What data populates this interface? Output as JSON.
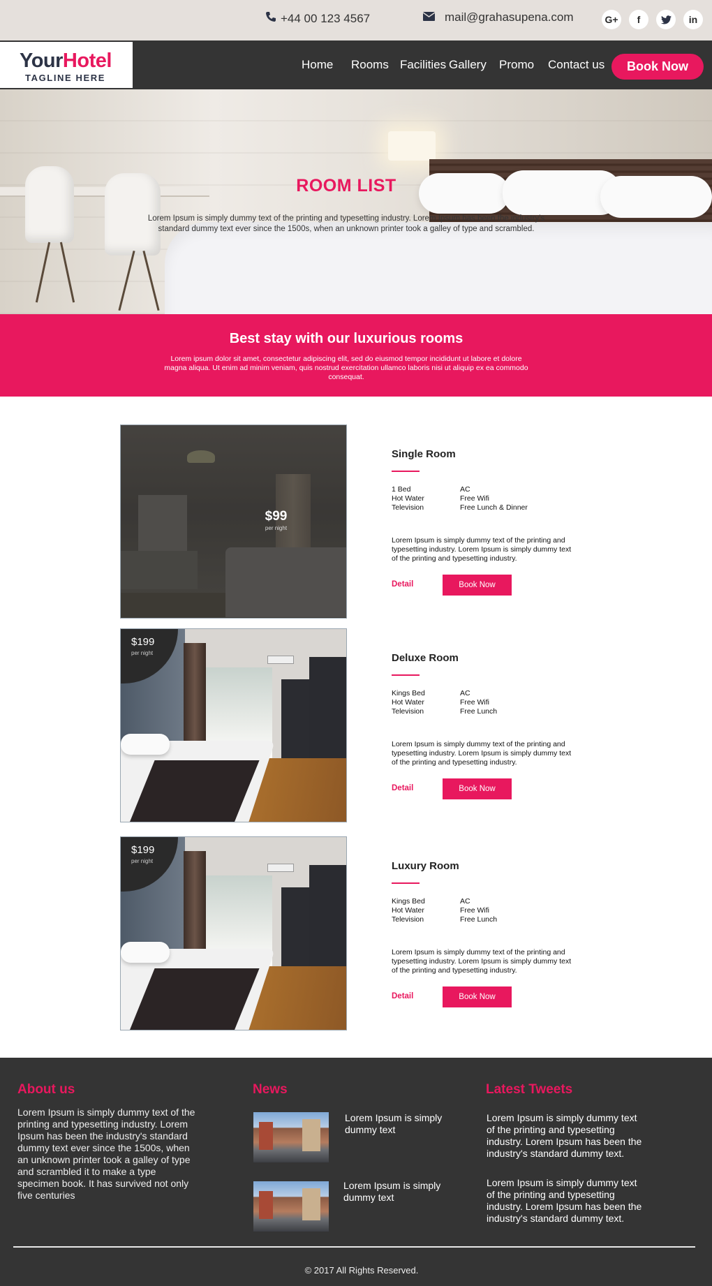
{
  "topbar": {
    "phone": "+44 00 123 4567",
    "email": "mail@grahasupena.com",
    "socials": [
      {
        "label": "G+",
        "icon": "google-plus-icon"
      },
      {
        "label": "f",
        "icon": "facebook-icon"
      },
      {
        "label": "t",
        "icon": "twitter-icon"
      },
      {
        "label": "in",
        "icon": "linkedin-icon"
      }
    ]
  },
  "logo": {
    "part1": "Your",
    "part2": "Hotel",
    "tagline": "TAGLINE HERE"
  },
  "nav": {
    "items": [
      "Home",
      "Rooms",
      "Facilities",
      "Gallery",
      "Promo",
      "Contact us"
    ],
    "book": "Book Now"
  },
  "hero": {
    "title": "ROOM LIST",
    "text": "Lorem Ipsum is simply dummy text of the printing and typesetting industry. Lorem Ipsum has been the industry's standard dummy text ever since the 1500s, when an unknown printer took a galley of type and scrambled."
  },
  "band": {
    "title": "Best stay with our luxurious rooms",
    "text": "Lorem ipsum dolor sit amet, consectetur adipiscing elit, sed do eiusmod tempor incididunt ut labore et dolore magna aliqua. Ut enim ad minim veniam, quis nostrud exercitation ullamco laboris nisi ut aliquip ex ea commodo consequat."
  },
  "rooms": [
    {
      "title": "Single Room",
      "price": "$99",
      "per": "per night",
      "features": [
        "1 Bed",
        "AC",
        "Hot Water",
        "Free Wifi",
        "Television",
        "Free Lunch & Dinner"
      ],
      "desc": "Lorem Ipsum is simply dummy text of the printing and typesetting industry. Lorem Ipsum is simply dummy text of the printing and typesetting industry.",
      "detail": "Detail",
      "book": "Book Now"
    },
    {
      "title": "Deluxe Room",
      "price": "$199",
      "per": "per night",
      "features": [
        "Kings Bed",
        "AC",
        "Hot Water",
        "Free Wifi",
        "Television",
        "Free Lunch"
      ],
      "desc": "Lorem Ipsum is simply dummy text of the printing and typesetting industry. Lorem Ipsum is simply dummy text of the printing and typesetting industry.",
      "detail": "Detail",
      "book": "Book Now"
    },
    {
      "title": "Luxury Room",
      "price": "$199",
      "per": "per night",
      "features": [
        "Kings Bed",
        "AC",
        "Hot Water",
        "Free Wifi",
        "Television",
        "Free Lunch"
      ],
      "desc": "Lorem Ipsum is simply dummy text of the printing and typesetting industry. Lorem Ipsum is simply dummy text of the printing and typesetting industry.",
      "detail": "Detail",
      "book": "Book Now"
    }
  ],
  "footer": {
    "about_title": "About us",
    "about_text": "Lorem Ipsum is simply dummy text of the printing and typesetting industry. Lorem Ipsum has been the industry's standard dummy text ever since the 1500s, when an unknown printer took a galley of type and scrambled it to make a type specimen book. It has survived not only five centuries",
    "news_title": "News",
    "news": [
      "Lorem Ipsum is simply dummy text",
      "Lorem Ipsum is simply dummy text"
    ],
    "tweets_title": "Latest Tweets",
    "tweets": [
      "Lorem Ipsum is simply dummy text of the printing and typesetting industry. Lorem Ipsum has been the industry's standard dummy text.",
      "Lorem Ipsum is simply dummy text of the printing and typesetting industry. Lorem Ipsum has been the industry's standard dummy text."
    ],
    "copyright": "© 2017 All Rights Reserved."
  },
  "colors": {
    "accent": "#e8185e",
    "dark": "#343434",
    "topbar": "#e5e0dc"
  }
}
